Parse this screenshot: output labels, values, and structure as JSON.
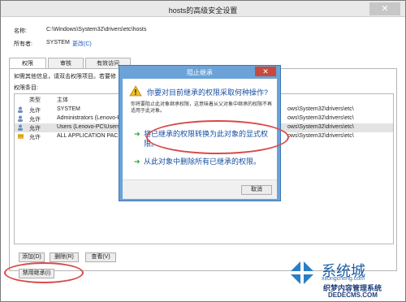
{
  "window": {
    "title": "hosts的高级安全设置"
  },
  "fields": {
    "name_label": "名称:",
    "name_value": "C:\\Windows\\System32\\drivers\\etc\\hosts",
    "owner_label": "所有者:",
    "owner_value": "SYSTEM",
    "change_link": "更改(C)"
  },
  "tabs": [
    "权限",
    "审核",
    "有效访问"
  ],
  "info_text": "如需其他信息，请双击权限项目。若要修",
  "perm_entries_label": "权限条目:",
  "columns": {
    "type": "类型",
    "principal": "主体"
  },
  "rows": [
    {
      "type": "允许",
      "principal": "SYSTEM",
      "inherit": "ows\\System32\\drivers\\etc\\"
    },
    {
      "type": "允许",
      "principal": "Administrators (Lenovo-P",
      "inherit": "ows\\System32\\drivers\\etc\\"
    },
    {
      "type": "允许",
      "principal": "Users (Lenovo-PC\\Users)",
      "inherit": "ows\\System32\\drivers\\etc\\"
    },
    {
      "type": "允许",
      "principal": "ALL APPLICATION PACKA",
      "inherit": "ows\\System32\\drivers\\etc\\"
    }
  ],
  "buttons": {
    "add": "添加(D)",
    "remove": "删除(R)",
    "view": "查看(V)",
    "disable_inherit": "禁用继承(I)"
  },
  "dialog": {
    "title": "阻止继承",
    "question": "你要对目前继承的权限采取何种操作?",
    "desc": "你将要阻止此对象继承权限，这意味着从父对象中继承的权限不再适用于此对象。",
    "option1": "将已继承的权限转换为此对象的显式权限。",
    "option2": "从此对象中删除所有已继承的权限。",
    "cancel": "取消"
  },
  "watermark": {
    "brand": "系统城",
    "site": "xitongcheng.com",
    "site2": "织梦内容管理系统",
    "site3": "DEDECMS.COM"
  }
}
